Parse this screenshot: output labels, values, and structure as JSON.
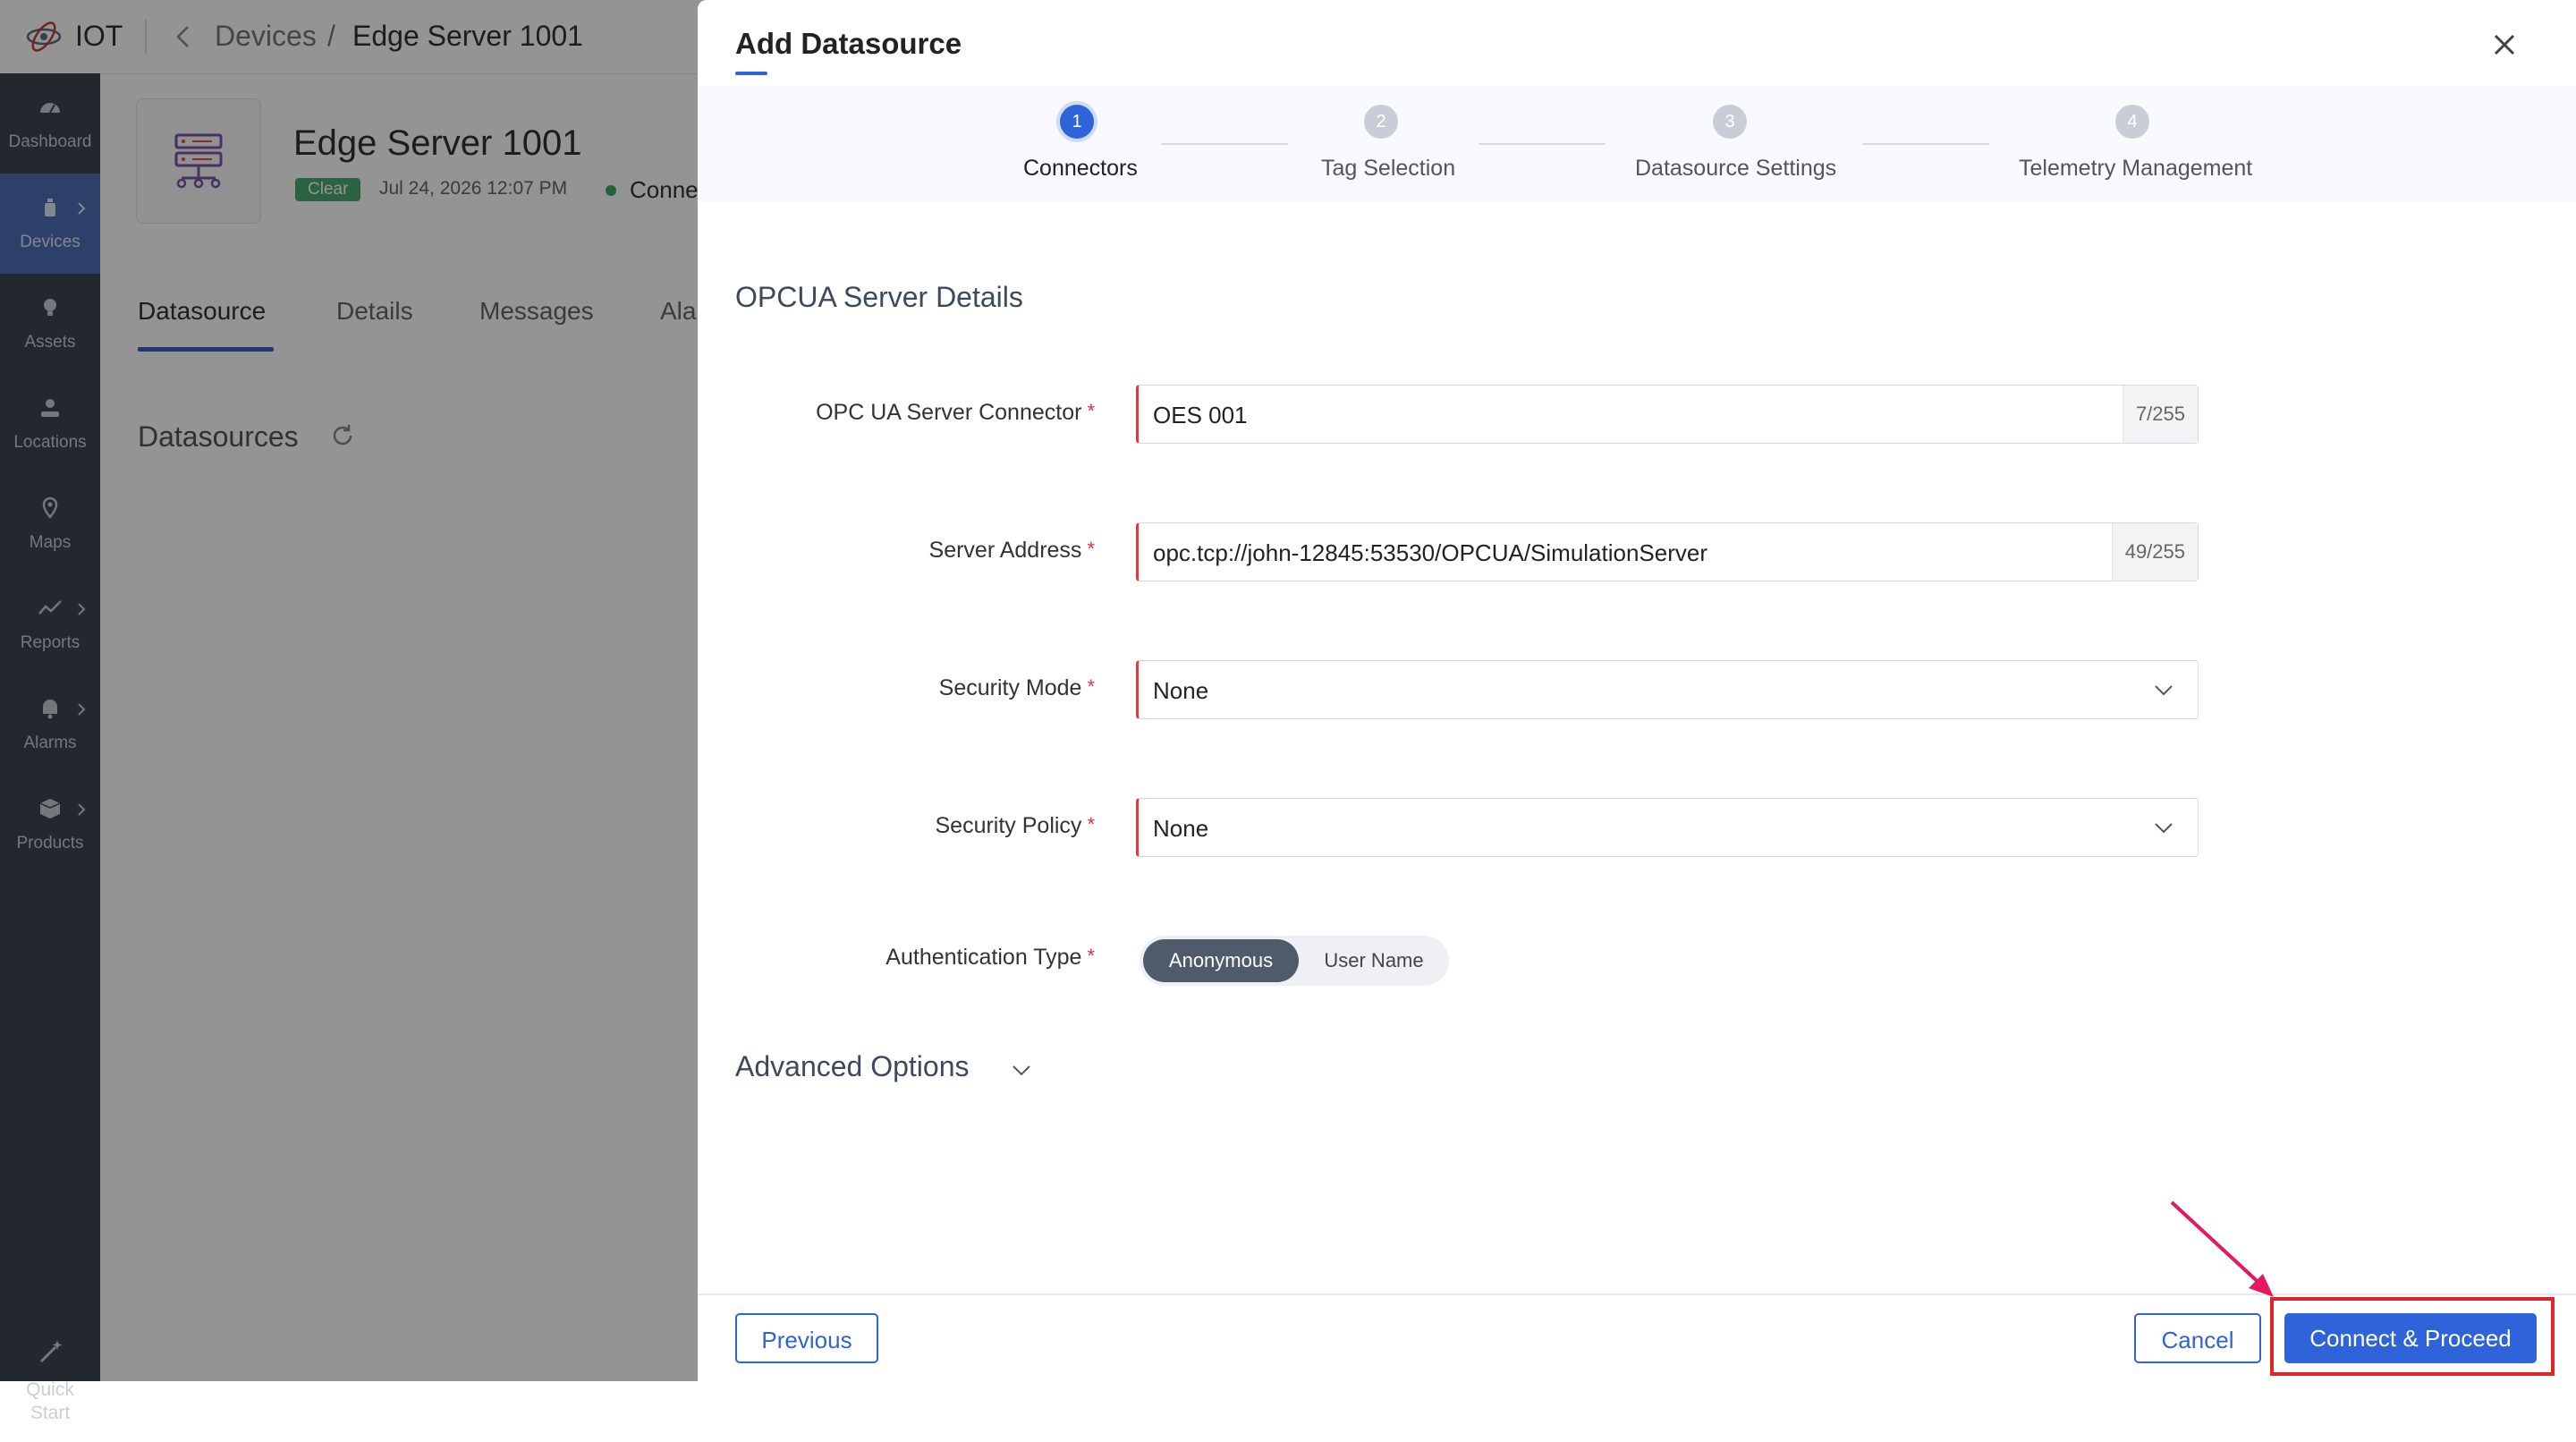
{
  "app": {
    "name": "IOT",
    "breadcrumb": {
      "devices": "Devices",
      "separator": "/",
      "current": "Edge Server 1001"
    }
  },
  "sidebar": {
    "items": [
      {
        "label": "Dashboard",
        "icon": "dashboard-icon"
      },
      {
        "label": "Devices",
        "icon": "devices-icon",
        "active": true
      },
      {
        "label": "Assets",
        "icon": "assets-icon"
      },
      {
        "label": "Locations",
        "icon": "locations-icon"
      },
      {
        "label": "Maps",
        "icon": "maps-icon"
      },
      {
        "label": "Reports",
        "icon": "reports-icon"
      },
      {
        "label": "Alarms",
        "icon": "alarms-icon"
      },
      {
        "label": "Products",
        "icon": "products-icon"
      }
    ],
    "quick_start": {
      "line1": "Quick",
      "line2": "Start"
    }
  },
  "device": {
    "title": "Edge Server 1001",
    "status_badge": "Clear",
    "timestamp": "Jul 24, 2026 12:07 PM",
    "connection": "Conne"
  },
  "tabs": [
    {
      "label": "Datasource",
      "active": true
    },
    {
      "label": "Details"
    },
    {
      "label": "Messages"
    },
    {
      "label": "Ala"
    }
  ],
  "datasources_heading": "Datasources",
  "drawer": {
    "title": "Add Datasource",
    "steps": [
      {
        "num": "1",
        "label": "Connectors",
        "active": true
      },
      {
        "num": "2",
        "label": "Tag Selection"
      },
      {
        "num": "3",
        "label": "Datasource Settings"
      },
      {
        "num": "4",
        "label": "Telemetry Management"
      }
    ],
    "section_title": "OPCUA Server Details",
    "required_mark": "*",
    "fields": {
      "connector": {
        "label": "OPC UA Server Connector",
        "value": "OES 001",
        "counter": "7/255"
      },
      "address": {
        "label": "Server Address",
        "value": "opc.tcp://john-12845:53530/OPCUA/SimulationServer",
        "counter": "49/255"
      },
      "security_mode": {
        "label": "Security Mode",
        "value": "None"
      },
      "security_policy": {
        "label": "Security Policy",
        "value": "None"
      },
      "auth_type": {
        "label": "Authentication Type",
        "options": [
          "Anonymous",
          "User Name"
        ],
        "selected": "Anonymous"
      }
    },
    "advanced_options": "Advanced Options",
    "buttons": {
      "previous": "Previous",
      "cancel": "Cancel",
      "connect": "Connect & Proceed"
    }
  },
  "colors": {
    "primary": "#2f63d9",
    "sidebar_bg": "#3d4450",
    "sidebar_active": "#4d6fb5",
    "required": "#e0363d",
    "status_clear": "#4bab72",
    "annotation": "#e0262b"
  }
}
